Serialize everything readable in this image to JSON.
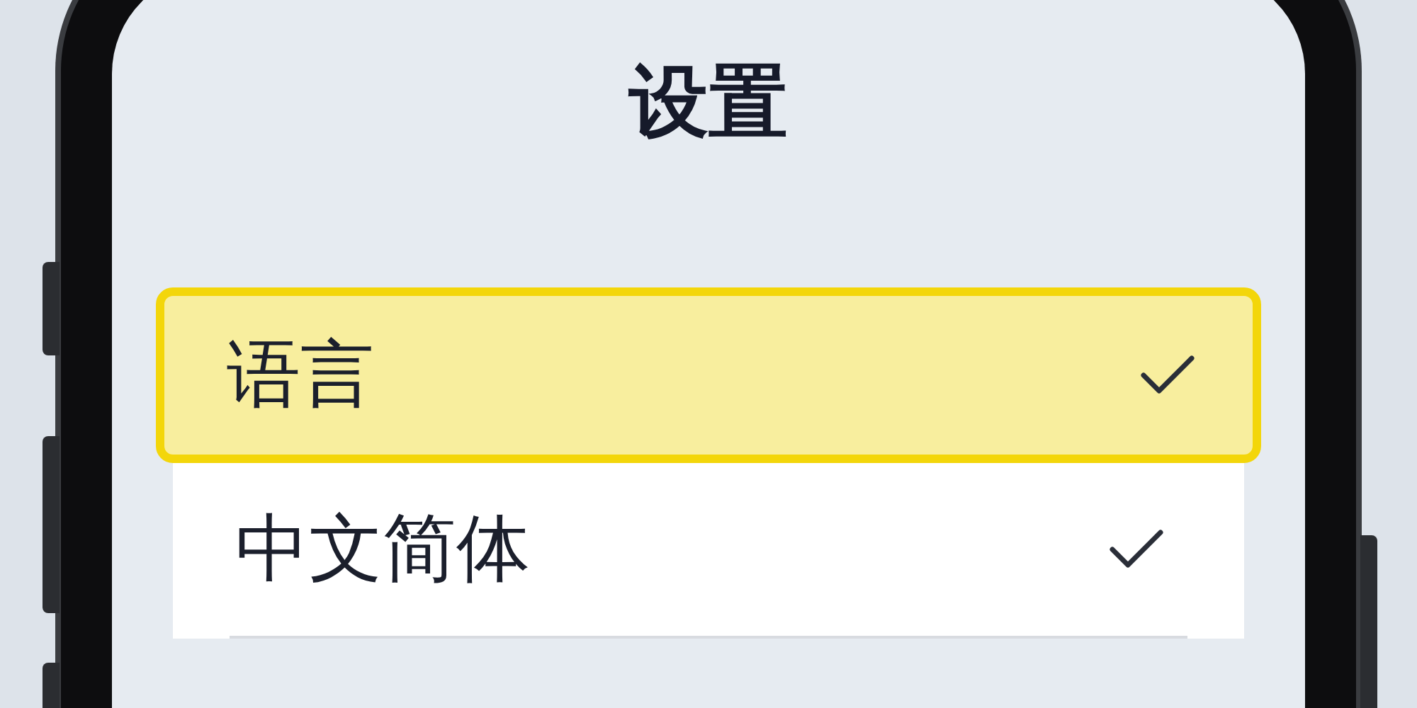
{
  "screen": {
    "title": "设置"
  },
  "items": [
    {
      "label": "语言",
      "selected": true,
      "checked": true
    },
    {
      "label": "中文简体",
      "selected": false,
      "checked": true
    }
  ]
}
